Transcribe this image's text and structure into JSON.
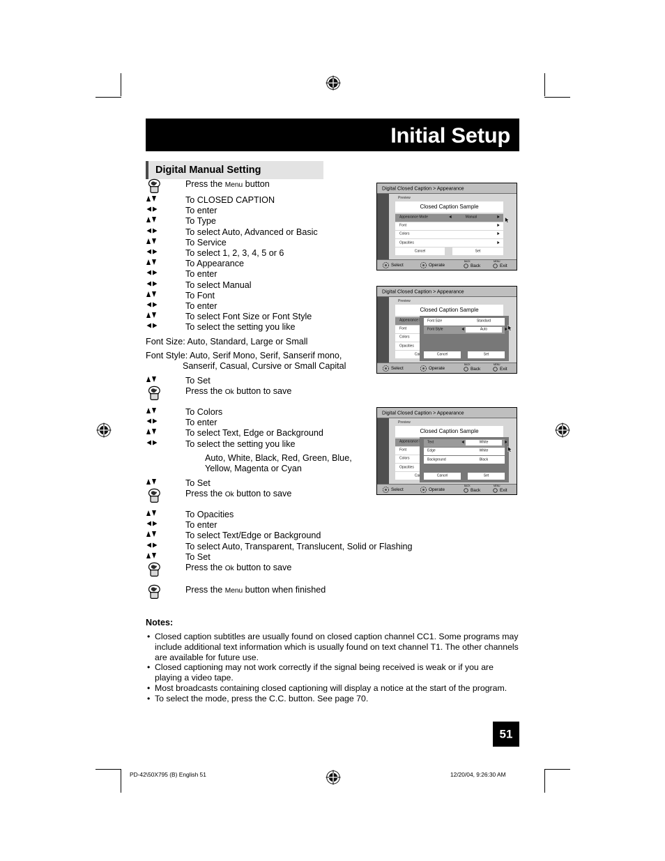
{
  "header": {
    "title": "Initial Setup",
    "section_heading": "Digital Manual Setting"
  },
  "steps": [
    {
      "key": "hand",
      "text": "Press the <sc>Menu</sc> button"
    },
    {
      "key": "updown",
      "text": "To CLOSED CAPTION"
    },
    {
      "key": "leftright",
      "text": "To enter"
    },
    {
      "key": "updown",
      "text": "To Type"
    },
    {
      "key": "leftright",
      "text": "To select Auto, Advanced or Basic"
    },
    {
      "key": "updown",
      "text": "To Service"
    },
    {
      "key": "leftright",
      "text": "To select 1, 2, 3, 4, 5 or 6"
    },
    {
      "key": "updown",
      "text": "To Appearance"
    },
    {
      "key": "leftright",
      "text": "To enter"
    },
    {
      "key": "leftright",
      "text": "To select Manual"
    },
    {
      "key": "updown",
      "text": "To Font"
    },
    {
      "key": "leftright",
      "text": "To enter"
    },
    {
      "key": "updown",
      "text": "To select Font Size or Font Style"
    },
    {
      "key": "leftright",
      "text": "To select the setting you like"
    }
  ],
  "font_notes": {
    "size_line": "Font Size: Auto, Standard, Large or Small",
    "style_line1": "Font Style: Auto, Serif Mono, Serif, Sanserif mono,",
    "style_line2": "Sanserif, Casual, Cursive or Small Capital"
  },
  "steps2": [
    {
      "key": "updown",
      "text": "To Set"
    },
    {
      "key": "hand",
      "text": "Press the <sc>Ok</sc> button to save"
    }
  ],
  "steps3": [
    {
      "key": "updown",
      "text": "To Colors"
    },
    {
      "key": "leftright",
      "text": "To enter"
    },
    {
      "key": "updown",
      "text": "To select Text, Edge or Background"
    },
    {
      "key": "leftright",
      "text": "To select the setting you like"
    }
  ],
  "color_notes": {
    "line1": "Auto, White, Black, Red, Green, Blue,",
    "line2": "Yellow, Magenta or Cyan"
  },
  "steps4": [
    {
      "key": "updown",
      "text": "To Set"
    },
    {
      "key": "hand",
      "text": "Press the <sc>Ok</sc> button to save"
    }
  ],
  "steps5": [
    {
      "key": "updown",
      "text": "To Opacities"
    },
    {
      "key": "leftright",
      "text": "To enter"
    },
    {
      "key": "updown",
      "text": "To select Text/Edge or Background"
    },
    {
      "key": "leftright",
      "text": "To select Auto, Transparent, Translucent, Solid or Flashing"
    },
    {
      "key": "updown",
      "text": "To Set"
    },
    {
      "key": "hand",
      "text": "Press the <sc>Ok</sc> button to save"
    }
  ],
  "steps6": [
    {
      "key": "hand",
      "text": "Press the <sc>Menu</sc> button when finished"
    }
  ],
  "osd_common": {
    "breadcrumb": "Digital Closed Caption  >  Appearance",
    "preview_label": "Preview",
    "sample_text": "Closed Caption Sample",
    "cancel_label": "Cancel",
    "set_label": "Set",
    "footer": [
      {
        "icon": "dpad-icon",
        "label": "Select",
        "mini": ""
      },
      {
        "icon": "dpad-icon",
        "label": "Operate",
        "mini": ""
      },
      {
        "icon": "circle-button-icon",
        "label": "Back",
        "mini": "BACK"
      },
      {
        "icon": "circle-button-icon",
        "label": "Exit",
        "mini": "MENU"
      }
    ]
  },
  "osd1": {
    "rows": [
      {
        "label": "Appearance Mode",
        "value": "Manual",
        "selected": true,
        "left_arrow": true,
        "right_arrow": true
      },
      {
        "label": "Font",
        "value": "",
        "selected": false,
        "left_arrow": false,
        "right_arrow": true
      },
      {
        "label": "Colors",
        "value": "",
        "selected": false,
        "left_arrow": false,
        "right_arrow": true
      },
      {
        "label": "Opacities",
        "value": "",
        "selected": false,
        "left_arrow": false,
        "right_arrow": true
      }
    ]
  },
  "osd2": {
    "rows": [
      {
        "label": "Appearance Mo",
        "value": "",
        "selected": true,
        "left_arrow": false,
        "right_arrow": false
      },
      {
        "label": "Font",
        "value": "",
        "selected": false,
        "left_arrow": false,
        "right_arrow": false
      },
      {
        "label": "Colors",
        "value": "",
        "selected": false,
        "left_arrow": false,
        "right_arrow": false
      },
      {
        "label": "Opacities",
        "value": "",
        "selected": false,
        "left_arrow": false,
        "right_arrow": false
      }
    ],
    "dialog": {
      "rows": [
        {
          "label": "Font Size",
          "value": "Standard",
          "selected": false,
          "left_arrow": false,
          "right_arrow": false
        },
        {
          "label": "Font Style",
          "value": "Auto",
          "selected": true,
          "left_arrow": true,
          "right_arrow": true
        }
      ],
      "cancel_label": "Cancel",
      "set_label": "Set"
    }
  },
  "osd3": {
    "rows": [
      {
        "label": "Appearance Mo",
        "value": "",
        "selected": true,
        "left_arrow": false,
        "right_arrow": false
      },
      {
        "label": "Font",
        "value": "",
        "selected": false,
        "left_arrow": false,
        "right_arrow": false
      },
      {
        "label": "Colors",
        "value": "",
        "selected": false,
        "left_arrow": false,
        "right_arrow": false
      },
      {
        "label": "Opacities",
        "value": "",
        "selected": false,
        "left_arrow": false,
        "right_arrow": false
      }
    ],
    "dialog": {
      "rows": [
        {
          "label": "Text",
          "value": "White",
          "selected": true,
          "left_arrow": true,
          "right_arrow": true
        },
        {
          "label": "Edge",
          "value": "White",
          "selected": false,
          "left_arrow": false,
          "right_arrow": false
        },
        {
          "label": "Background",
          "value": "Black",
          "selected": false,
          "left_arrow": false,
          "right_arrow": false
        }
      ],
      "cancel_label": "Cancel",
      "set_label": "Set"
    }
  },
  "notes": {
    "title": "Notes:",
    "items": [
      "Closed caption subtitles are usually found on closed caption channel CC1. Some programs may include additional text information which is usually found on text channel T1. The other channels are available for future use.",
      "Closed captioning may not work correctly if the signal being received is weak or if you are playing a video tape.",
      "Most broadcasts containing closed captioning will display a notice at the start of the program.",
      "To select the mode, press the C.C. button. See page 70."
    ]
  },
  "page_number": "51",
  "footer": {
    "left": "PD-42\\50X795 (B) English   51",
    "right": "12/20/04, 9:26:30 AM"
  }
}
